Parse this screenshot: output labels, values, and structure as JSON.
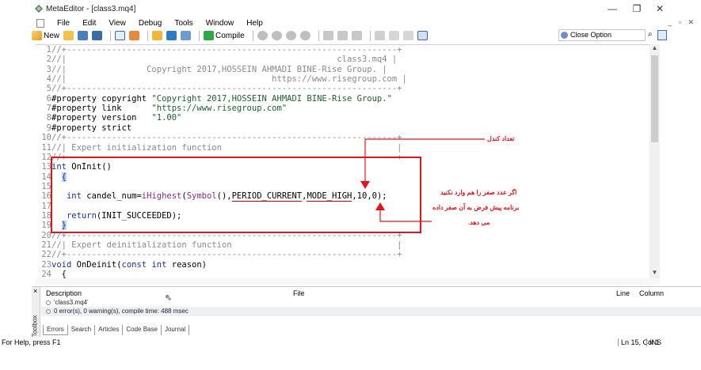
{
  "window": {
    "title": "MetaEditor - [class3.mq4]",
    "controls": {
      "minimize": "—",
      "maximize": "❐",
      "close": "✕"
    }
  },
  "menu": [
    "File",
    "Edit",
    "View",
    "Debug",
    "Tools",
    "Window",
    "Help"
  ],
  "toolbar": {
    "new_label": "New",
    "compile_label": "Compile",
    "search_value": "Close Option"
  },
  "editor": {
    "lines": [
      {
        "n": "1",
        "text": "//+------------------------------------------------------------------+"
      },
      {
        "n": "2",
        "text": "//|                                                      class3.mq4 |"
      },
      {
        "n": "3",
        "text": "//|                Copyright 2017,HOSSEIN AHMADI BINE-Rise Group. |"
      },
      {
        "n": "4",
        "text": "//|                                         https://www.risegroup.com |"
      },
      {
        "n": "5",
        "text": "//+------------------------------------------------------------------+"
      },
      {
        "n": "6",
        "text": "#property copyright \"Copyright 2017,HOSSEIN AHMADI BINE-Rise Group.\""
      },
      {
        "n": "7",
        "text": "#property link      \"https://www.risegroup.com\""
      },
      {
        "n": "8",
        "text": "#property version   \"1.00\""
      },
      {
        "n": "9",
        "text": "#property strict"
      },
      {
        "n": "10",
        "text": "//+------------------------------------------------------------------+"
      },
      {
        "n": "11",
        "text": "//| Expert initialization function                                   |"
      },
      {
        "n": "12",
        "text": "//+------------------------------------------------------------------+"
      },
      {
        "n": "13",
        "text": "int OnInit()"
      },
      {
        "n": "14",
        "text": "  {"
      },
      {
        "n": "15",
        "text": ""
      },
      {
        "n": "16",
        "text": "   int candel_num=iHighest(Symbol(),PERIOD_CURRENT,MODE_HIGH,10,0);"
      },
      {
        "n": "17",
        "text": ""
      },
      {
        "n": "18",
        "text": "   return(INIT_SUCCEEDED);"
      },
      {
        "n": "19",
        "text": "  }"
      },
      {
        "n": "20",
        "text": "//+------------------------------------------------------------------+"
      },
      {
        "n": "21",
        "text": "//| Expert deinitialization function                                 |"
      },
      {
        "n": "22",
        "text": "//+------------------------------------------------------------------+"
      },
      {
        "n": "23",
        "text": "void OnDeinit(const int reason)"
      },
      {
        "n": "24",
        "text": "  {"
      }
    ]
  },
  "annotations": {
    "candle_count": "تعداد کندل",
    "note_line1": "اگر عدد صفر را هم وارد نکنید",
    "note_line2": "برنامه پیش فرض به آن صفر داده",
    "note_line3": "می دهد."
  },
  "toolbox": {
    "side_label": "Toolbox",
    "col_description": "Description",
    "col_file": "File",
    "col_line": "Line",
    "col_column": "Column",
    "msg1": "'class3.mq4'",
    "msg2": "0 error(s), 0 warning(s), compile time: 488 msec",
    "tabs": [
      "Errors",
      "Search",
      "Articles",
      "Code Base",
      "Journal"
    ]
  },
  "statusbar": {
    "help": "For Help, press F1",
    "position": "Ln 15, Col 1",
    "mode": "INS"
  },
  "colors": {
    "annotation_red": "#e3141b",
    "comment_gray": "#8a8a8a",
    "string_green": "#1d5e2f",
    "keyword_blue": "#1b2da0"
  }
}
